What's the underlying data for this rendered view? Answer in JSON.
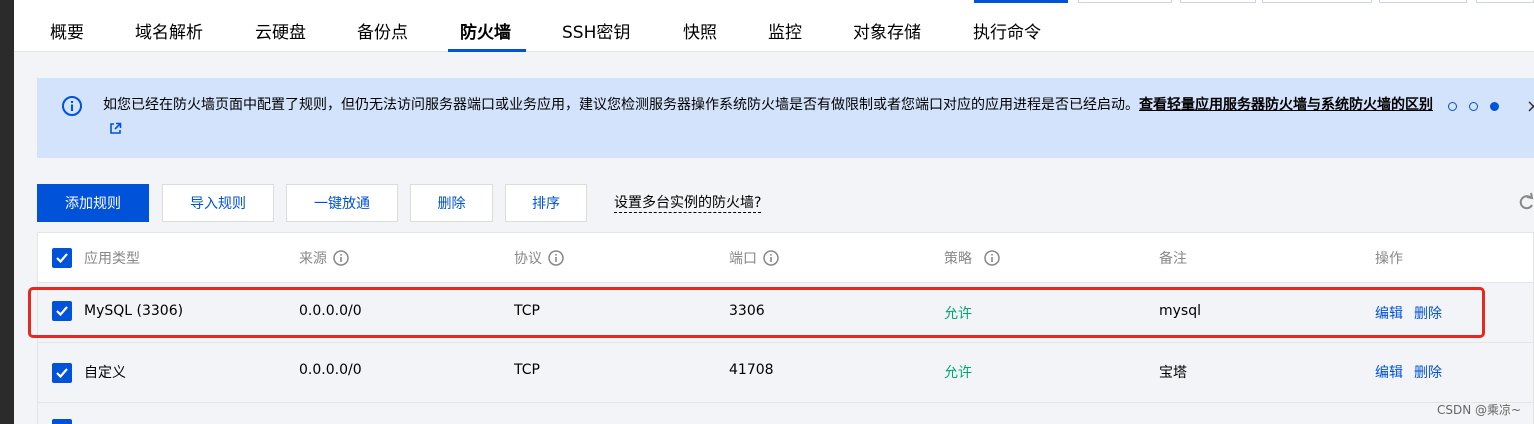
{
  "tabs": [
    {
      "label": "概要"
    },
    {
      "label": "域名解析"
    },
    {
      "label": "云硬盘"
    },
    {
      "label": "备份点"
    },
    {
      "label": "防火墙",
      "active": true
    },
    {
      "label": "SSH密钥"
    },
    {
      "label": "快照"
    },
    {
      "label": "监控"
    },
    {
      "label": "对象存储"
    },
    {
      "label": "执行命令"
    }
  ],
  "banner": {
    "text": "如您已经在防火墙页面中配置了规则，但仍无法访问服务器端口或业务应用，建议您检测服务器操作系统防火墙是否有做限制或者您端口对应的应用进程是否已经启动。",
    "link": "查看轻量应用服务器防火墙与系统防火墙的区别",
    "close": "×",
    "icon": "info-icon",
    "page_dots": 3,
    "active_dot": 3
  },
  "toolbar": {
    "add_rule": "添加规则",
    "import_rules": "导入规则",
    "one_click_open": "一键放通",
    "delete": "删除",
    "sort": "排序",
    "multi_instance_link": "设置多台实例的防火墙?"
  },
  "table": {
    "headers": {
      "app_type": "应用类型",
      "source": "来源",
      "protocol": "协议",
      "port": "端口",
      "policy": "策略",
      "remark": "备注",
      "actions": "操作"
    },
    "rows": [
      {
        "app_type": "MySQL (3306)",
        "source": "0.0.0.0/0",
        "protocol": "TCP",
        "port": "3306",
        "policy": "允许",
        "remark": "mysql",
        "edit": "编辑",
        "delete": "删除",
        "checked": true,
        "highlighted": true
      },
      {
        "app_type": "自定义",
        "source": "0.0.0.0/0",
        "protocol": "TCP",
        "port": "41708",
        "policy": "允许",
        "remark": "宝塔",
        "edit": "编辑",
        "delete": "删除",
        "checked": true
      }
    ]
  },
  "colors": {
    "primary": "#0052d9",
    "allow": "#00a870",
    "banner_bg": "#d4e3fc",
    "highlight_border": "#e8281f"
  },
  "watermark": "CSDN @乘凉~"
}
